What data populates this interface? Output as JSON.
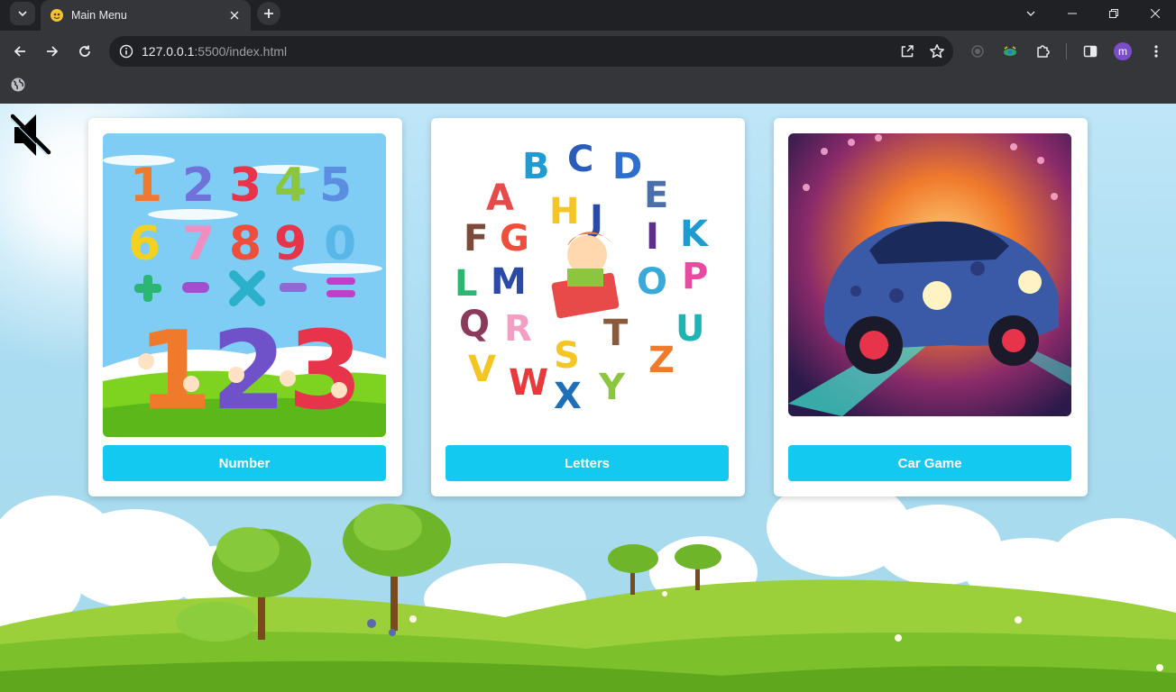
{
  "browser": {
    "tab_title": "Main Menu",
    "url_host": "127.0.0.1",
    "url_rest": ":5500/index.html",
    "profile_initial": "m"
  },
  "page": {
    "mute_icon": "speaker-muted-icon",
    "cards": [
      {
        "label": "Number",
        "image": "numbers-illustration"
      },
      {
        "label": "Letters",
        "image": "alphabet-illustration"
      },
      {
        "label": "Car Game",
        "image": "neon-car-illustration"
      }
    ],
    "colors": {
      "button": "#13c9ef",
      "card": "#ffffff",
      "sky": "#aadcf1",
      "grass": "#7cc02c"
    }
  }
}
